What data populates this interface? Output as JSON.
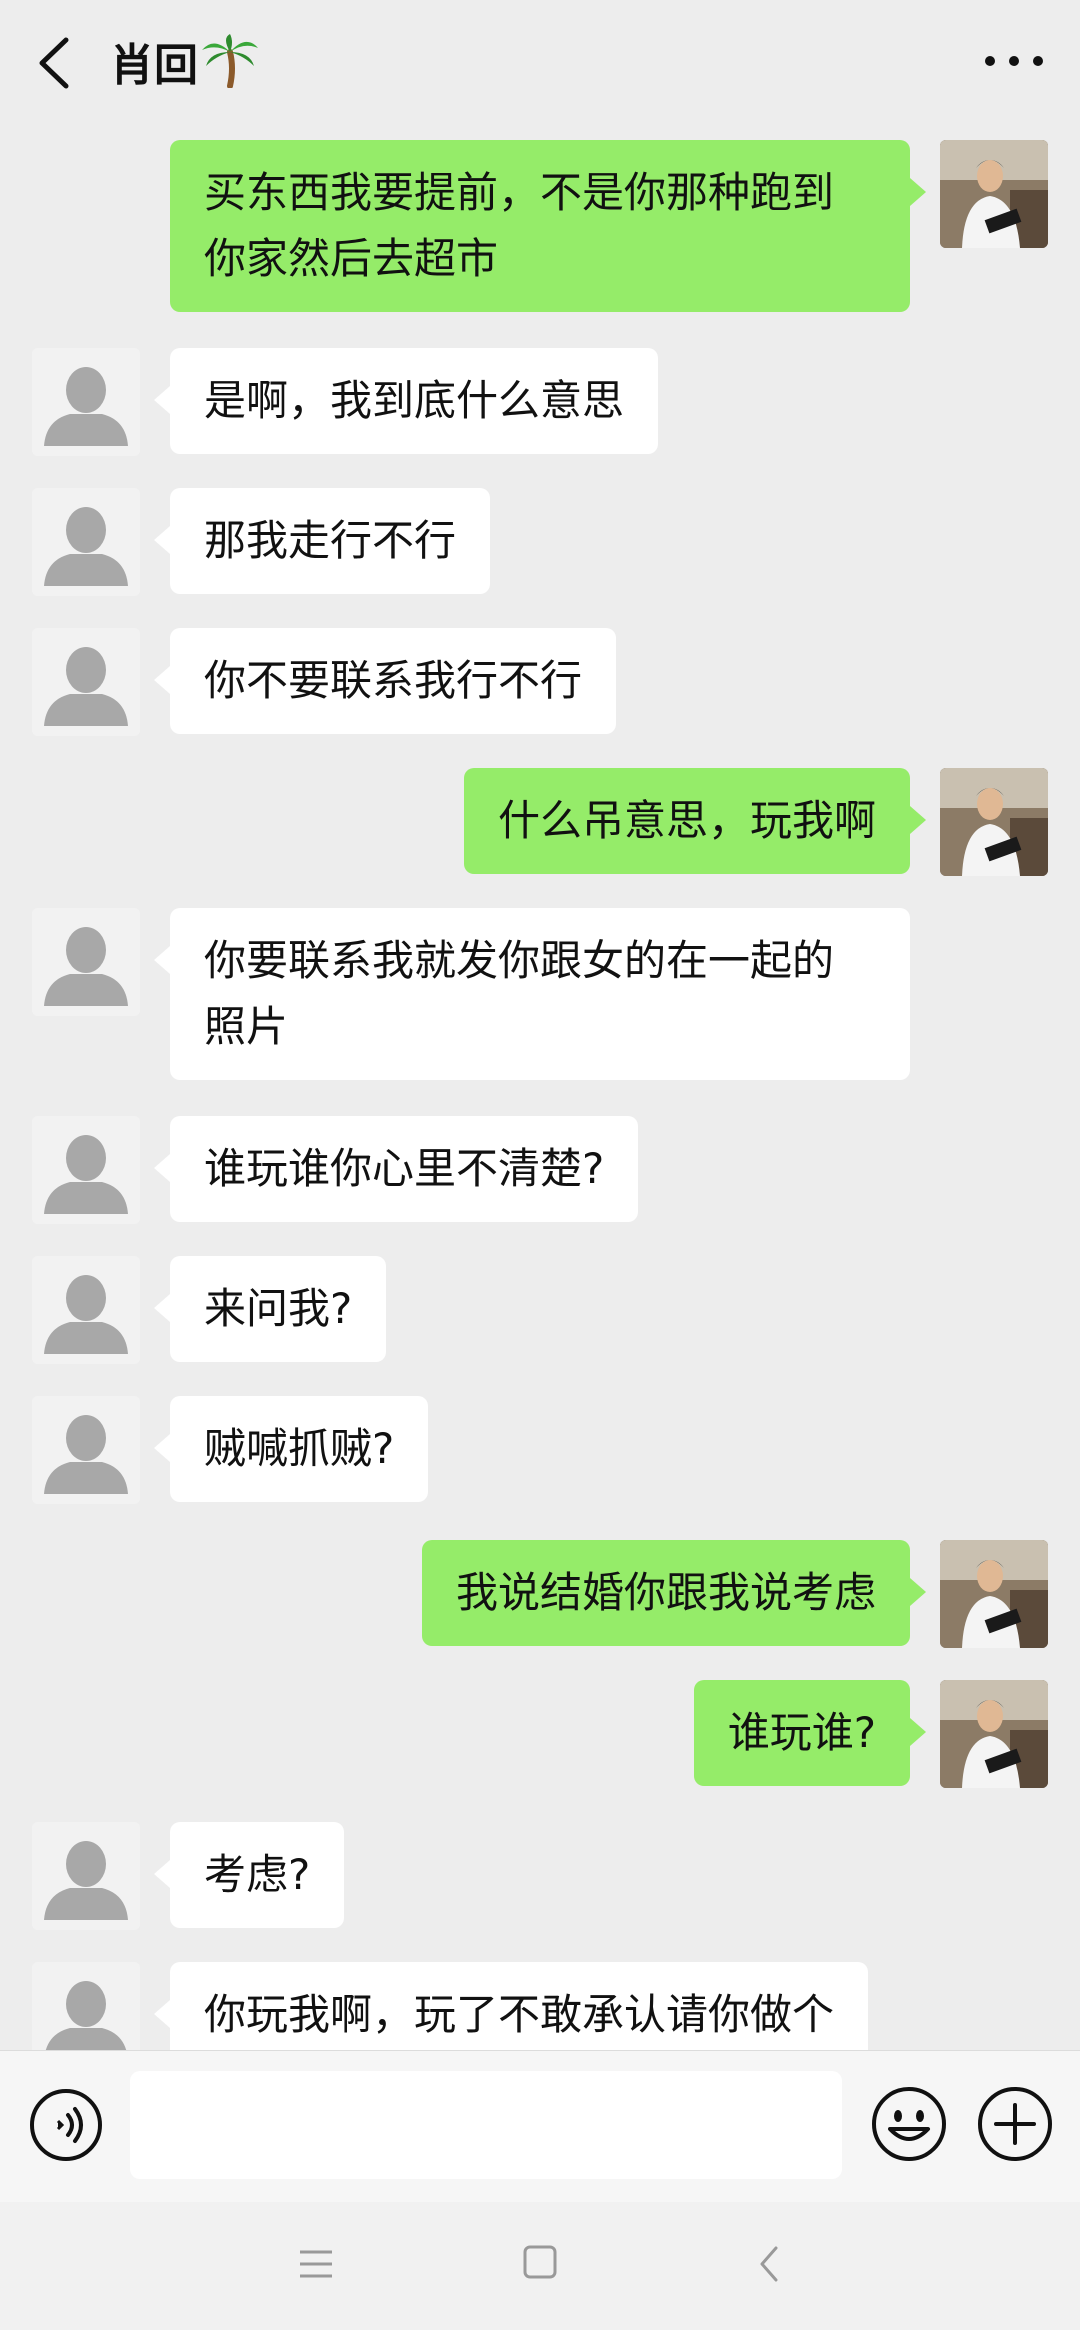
{
  "header": {
    "title": "肖回"
  },
  "messages": [
    {
      "side": "right",
      "text": "买东西我要提前，不是你那种跑到\n你家然后去超市"
    },
    {
      "side": "left",
      "text": "是啊，我到底什么意思"
    },
    {
      "side": "left",
      "text": "那我走行不行"
    },
    {
      "side": "left",
      "text": "你不要联系我行不行"
    },
    {
      "side": "right",
      "text": "什么吊意思，玩我啊"
    },
    {
      "side": "left",
      "text": "你要联系我就发你跟女的在一起的\n照片"
    },
    {
      "side": "left",
      "text": "谁玩谁你心里不清楚?"
    },
    {
      "side": "left",
      "text": "来问我?"
    },
    {
      "side": "left",
      "text": "贼喊抓贼?"
    },
    {
      "side": "right",
      "text": "我说结婚你跟我说考虑"
    },
    {
      "side": "right",
      "text": "谁玩谁?"
    },
    {
      "side": "left",
      "text": "考虑?"
    },
    {
      "side": "left",
      "text": "你玩我啊，玩了不敢承认请你做个"
    }
  ],
  "input": {
    "placeholder": ""
  },
  "colors": {
    "sent_bubble": "#95ec69",
    "received_bubble": "#ffffff",
    "background": "#ededed"
  },
  "icons": {
    "back": "chevron-left-icon",
    "more": "more-dots-icon",
    "voice": "voice-icon",
    "emoji": "emoji-icon",
    "plus": "plus-icon",
    "palm": "palm-tree-icon"
  }
}
